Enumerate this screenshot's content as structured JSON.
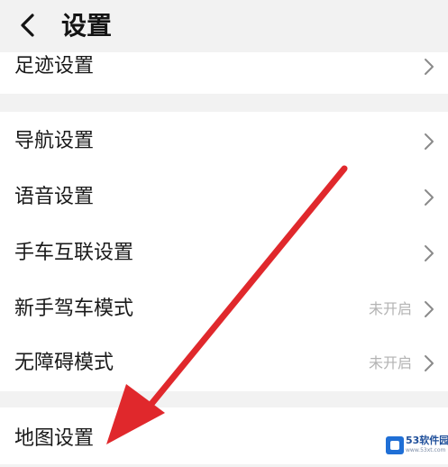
{
  "header": {
    "title": "设置",
    "back_icon": "chevron-left-icon"
  },
  "groups": [
    {
      "rows": [
        {
          "label": "足迹设置",
          "status": ""
        }
      ]
    },
    {
      "rows": [
        {
          "label": "导航设置",
          "status": ""
        },
        {
          "label": "语音设置",
          "status": ""
        },
        {
          "label": "手车互联设置",
          "status": ""
        },
        {
          "label": "新手驾车模式",
          "status": "未开启"
        },
        {
          "label": "无障碍模式",
          "status": "未开启"
        }
      ]
    },
    {
      "rows": [
        {
          "label": "地图设置",
          "status": ""
        }
      ]
    }
  ],
  "annotation": {
    "color": "#e0282c",
    "points_to": "地图设置"
  },
  "watermark": {
    "text": "53软件园",
    "sub": "www.53xt.com"
  },
  "colors": {
    "background": "#f2f2f2",
    "card": "#ffffff",
    "status_text": "#b3b3b3",
    "arrow": "#e0282c"
  }
}
